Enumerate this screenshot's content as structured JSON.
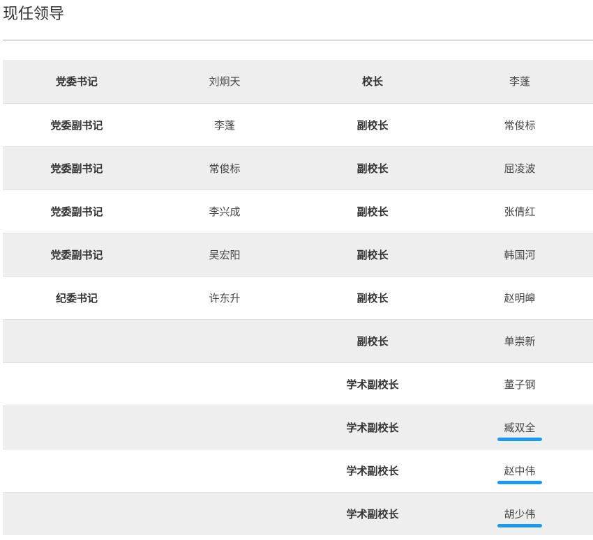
{
  "page": {
    "title": "现任领导"
  },
  "colors": {
    "row_stripe": "#eeeeee",
    "row_plain": "#ffffff",
    "link_underline": "#1a9bef"
  },
  "leaders": {
    "rows": [
      {
        "party_role": "党委书记",
        "party_name": "刘炯天",
        "admin_role": "校长",
        "admin_name": "李蓬"
      },
      {
        "party_role": "党委副书记",
        "party_name": "李蓬",
        "admin_role": "副校长",
        "admin_name": "常俊标"
      },
      {
        "party_role": "党委副书记",
        "party_name": "常俊标",
        "admin_role": "副校长",
        "admin_name": "屈凌波"
      },
      {
        "party_role": "党委副书记",
        "party_name": "李兴成",
        "admin_role": "副校长",
        "admin_name": "张倩红"
      },
      {
        "party_role": "党委副书记",
        "party_name": "吴宏阳",
        "admin_role": "副校长",
        "admin_name": "韩国河"
      },
      {
        "party_role": "纪委书记",
        "party_name": "许东升",
        "admin_role": "副校长",
        "admin_name": "赵明皞"
      },
      {
        "party_role": "",
        "party_name": "",
        "admin_role": "副校长",
        "admin_name": "单崇新"
      },
      {
        "party_role": "",
        "party_name": "",
        "admin_role": "学术副校长",
        "admin_name": "董子钢"
      },
      {
        "party_role": "",
        "party_name": "",
        "admin_role": "学术副校长",
        "admin_name": "臧双全"
      },
      {
        "party_role": "",
        "party_name": "",
        "admin_role": "学术副校长",
        "admin_name": "赵中伟"
      },
      {
        "party_role": "",
        "party_name": "",
        "admin_role": "学术副校长",
        "admin_name": "胡少伟"
      }
    ]
  }
}
